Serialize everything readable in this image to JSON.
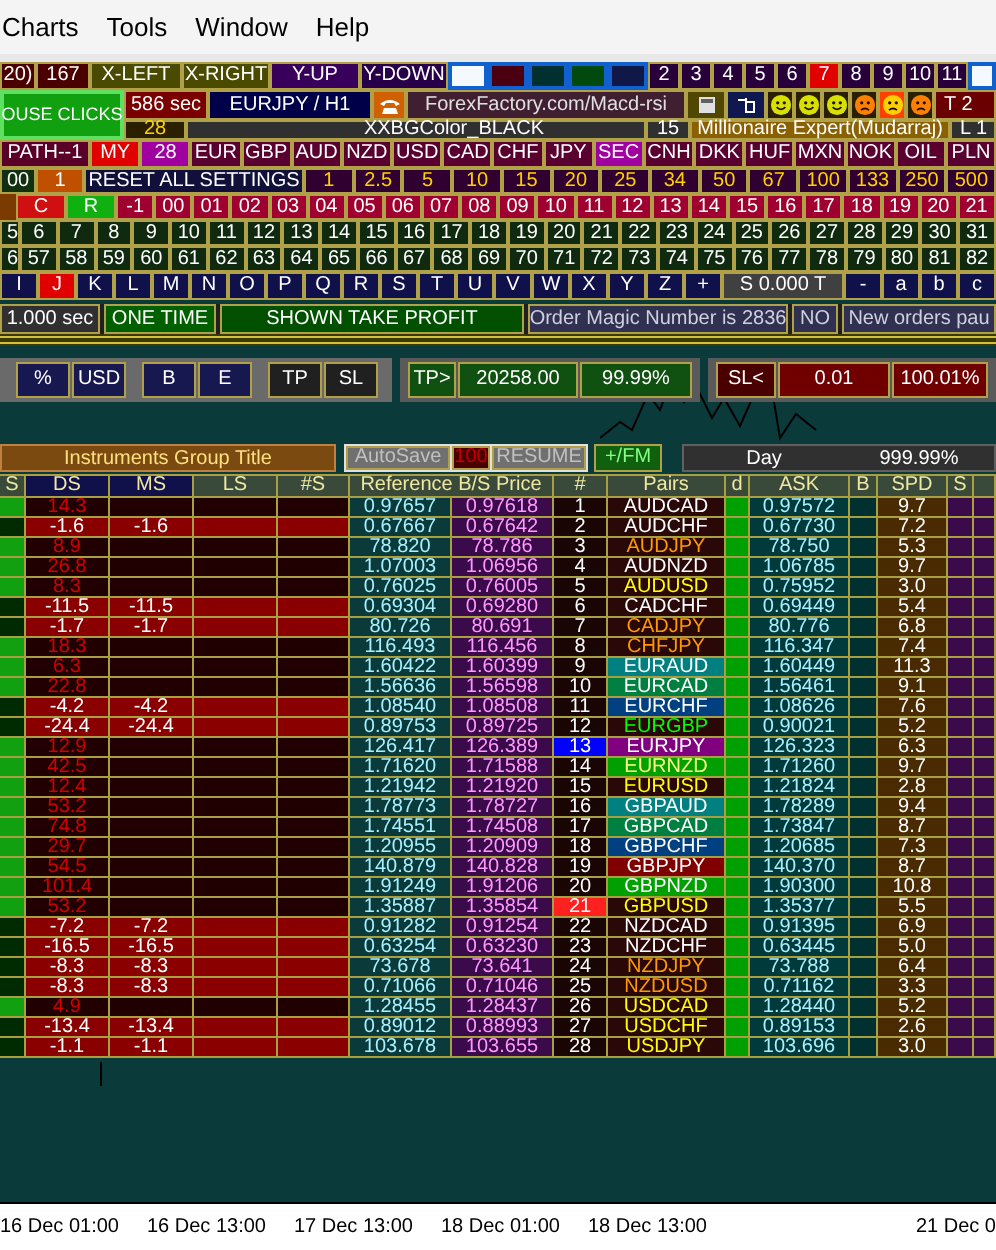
{
  "menu": [
    "Charts",
    "Tools",
    "Window",
    "Help"
  ],
  "toolbar_1": [
    {
      "label": "20)",
      "color": "#4a0000"
    },
    {
      "label": "167",
      "color": "#4a0000"
    },
    {
      "label": "X-LEFT",
      "color": "#4a4a00"
    },
    {
      "label": "X-RIGHT",
      "color": "#4a4a00"
    },
    {
      "label": "Y-UP",
      "color": "#38005a"
    },
    {
      "label": "Y-DOWN",
      "color": "#28004a"
    }
  ],
  "swatches": [
    {
      "color": "#f4f8ff"
    },
    {
      "color": "#4a0010"
    },
    {
      "color": "#003030"
    },
    {
      "color": "#004a10"
    },
    {
      "color": "#101848"
    },
    {
      "color": "#f4f8ff"
    }
  ],
  "chart_numbers": [
    {
      "label": "2"
    },
    {
      "label": "3"
    },
    {
      "label": "4"
    },
    {
      "label": "5"
    },
    {
      "label": "6"
    },
    {
      "label": "7",
      "color": "#e00000"
    },
    {
      "label": "8"
    },
    {
      "label": "9"
    },
    {
      "label": "10"
    },
    {
      "label": "11"
    }
  ],
  "info": {
    "mouse_clicks": "OUSE CLICKS",
    "timer": "586 sec",
    "symbol": "EURJPY / H1",
    "link": "ForexFactory.com/Macd-rsi",
    "corner": "T 2",
    "count": "28",
    "bg_setting": "XXBGColor_BLACK",
    "number": "15",
    "expert": "Millionaire Expert(Mudarraj)",
    "corner_2": "L 1"
  },
  "smileys": [
    {
      "kind": "happy",
      "color": "#d8e000",
      "selected": false
    },
    {
      "kind": "happy",
      "color": "#d8e000",
      "selected": false
    },
    {
      "kind": "happy",
      "color": "#d8e000",
      "selected": false
    },
    {
      "kind": "sad",
      "color": "#ff8000",
      "selected": false
    },
    {
      "kind": "sad",
      "color": "#ffd000",
      "selected": true
    },
    {
      "kind": "sad",
      "color": "#ff8000",
      "selected": false
    }
  ],
  "currencies": [
    {
      "label": "PATH--1",
      "color": "#5a0028"
    },
    {
      "label": "MY",
      "color": "#e00000"
    },
    {
      "label": "28",
      "color": "#a000a0"
    },
    {
      "label": "EUR"
    },
    {
      "label": "GBP"
    },
    {
      "label": "AUD"
    },
    {
      "label": "NZD"
    },
    {
      "label": "USD"
    },
    {
      "label": "CAD"
    },
    {
      "label": "CHF"
    },
    {
      "label": "JPY"
    },
    {
      "label": "SEC",
      "color": "#a000a0"
    },
    {
      "label": "CNH"
    },
    {
      "label": "DKK"
    },
    {
      "label": "HUF"
    },
    {
      "label": "MXN"
    },
    {
      "label": "NOK"
    },
    {
      "label": "OIL"
    },
    {
      "label": "PLN"
    }
  ],
  "settings": [
    {
      "label": "00",
      "color": "#103010"
    },
    {
      "label": "1",
      "color": "#c05000"
    },
    {
      "label": "RESET ALL SETTINGS",
      "color": "#10103a"
    },
    {
      "label": "1"
    },
    {
      "label": "2.5"
    },
    {
      "label": "5"
    },
    {
      "label": "10"
    },
    {
      "label": "15"
    },
    {
      "label": "20"
    },
    {
      "label": "25"
    },
    {
      "label": "34"
    },
    {
      "label": "50"
    },
    {
      "label": "67"
    },
    {
      "label": "100"
    },
    {
      "label": "133"
    },
    {
      "label": "250"
    },
    {
      "label": "500"
    }
  ],
  "minutes": [
    {
      "label": "C",
      "color": "#d01010"
    },
    {
      "label": "R",
      "color": "#10b010"
    },
    {
      "label": "-1"
    },
    {
      "label": "00"
    },
    {
      "label": "01"
    },
    {
      "label": "02"
    },
    {
      "label": "03"
    },
    {
      "label": "04"
    },
    {
      "label": "05"
    },
    {
      "label": "06"
    },
    {
      "label": "07"
    },
    {
      "label": "08"
    },
    {
      "label": "09"
    },
    {
      "label": "10"
    },
    {
      "label": "11"
    },
    {
      "label": "12"
    },
    {
      "label": "13"
    },
    {
      "label": "14"
    },
    {
      "label": "15"
    },
    {
      "label": "16"
    },
    {
      "label": "17"
    },
    {
      "label": "18"
    },
    {
      "label": "19"
    },
    {
      "label": "20"
    },
    {
      "label": "21"
    }
  ],
  "numbers_a": [
    "5",
    "6",
    "7",
    "8",
    "9",
    "10",
    "11",
    "12",
    "13",
    "14",
    "15",
    "16",
    "17",
    "18",
    "19",
    "20",
    "21",
    "22",
    "23",
    "24",
    "25",
    "26",
    "27",
    "28",
    "29",
    "30",
    "31"
  ],
  "numbers_b": [
    "6",
    "57",
    "58",
    "59",
    "60",
    "61",
    "62",
    "63",
    "64",
    "65",
    "66",
    "67",
    "68",
    "69",
    "70",
    "71",
    "72",
    "73",
    "74",
    "75",
    "76",
    "77",
    "78",
    "79",
    "80",
    "81",
    "82"
  ],
  "letters": [
    {
      "label": "I"
    },
    {
      "label": "J",
      "color": "#e00000"
    },
    {
      "label": "K"
    },
    {
      "label": "L"
    },
    {
      "label": "M"
    },
    {
      "label": "N"
    },
    {
      "label": "O"
    },
    {
      "label": "P"
    },
    {
      "label": "Q"
    },
    {
      "label": "R"
    },
    {
      "label": "S"
    },
    {
      "label": "T"
    },
    {
      "label": "U"
    },
    {
      "label": "V"
    },
    {
      "label": "W"
    },
    {
      "label": "X"
    },
    {
      "label": "Y"
    },
    {
      "label": "Z"
    },
    {
      "label": "+"
    },
    {
      "label": "S 0.000 T",
      "color": "#404040"
    },
    {
      "label": "-"
    },
    {
      "label": "a"
    },
    {
      "label": "b"
    },
    {
      "label": "c"
    }
  ],
  "status": [
    {
      "label": "1.000 sec",
      "color": "#303030"
    },
    {
      "label": "ONE TIME",
      "color": "#006000"
    },
    {
      "label": "SHOWN TAKE PROFIT",
      "color": "#005000"
    },
    {
      "label": "Order Magic Number is 2836",
      "color": "#303050"
    },
    {
      "label": "NO",
      "color": "#303050"
    },
    {
      "label": "New orders pau",
      "color": "#303050"
    }
  ],
  "mode_buttons": [
    "%",
    "USD",
    "B",
    "E",
    "TP",
    "SL"
  ],
  "take_profit": [
    "TP>",
    "20258.00",
    "99.99%"
  ],
  "stop_loss": [
    "SL<",
    "0.01",
    "100.01%"
  ],
  "group_title": "Instruments Group Title",
  "autosave": "AutoSave",
  "autosave_value": "100",
  "resume": "RESUME",
  "fm": "+/FM",
  "period": "Day",
  "period_value": "999.99%",
  "columns": [
    "S",
    "DS",
    "MS",
    "LS",
    "#S",
    "Reference B/S Price",
    "#",
    "Pairs",
    "d",
    "ASK",
    "B",
    "SPD",
    "S"
  ],
  "rows": [
    {
      "kind": "up",
      "ds": "14.3",
      "buy": "0.97657",
      "sell": "0.97618",
      "num": "1",
      "pair": {
        "label": "AUDCAD",
        "kind": "white",
        "color": "#2a0808"
      },
      "ask": "0.97572",
      "spd": "9.7"
    },
    {
      "kind": "down",
      "ds": "-1.6",
      "ms": "-1.6",
      "buy": "0.67667",
      "sell": "0.67642",
      "num": "2",
      "pair": {
        "label": "AUDCHF",
        "kind": "white",
        "color": "#2a0808"
      },
      "ask": "0.67730",
      "spd": "7.2"
    },
    {
      "kind": "up",
      "ds": "8.9",
      "buy": "78.820",
      "sell": "78.786",
      "num": "3",
      "pair": {
        "label": "AUDJPY",
        "kind": "orange",
        "color": "#2a0808"
      },
      "ask": "78.750",
      "spd": "5.3"
    },
    {
      "kind": "up",
      "ds": "26.8",
      "buy": "1.07003",
      "sell": "1.06956",
      "num": "4",
      "pair": {
        "label": "AUDNZD",
        "kind": "white",
        "color": "#2a0808"
      },
      "ask": "1.06785",
      "spd": "9.7"
    },
    {
      "kind": "up",
      "ds": "8.3",
      "buy": "0.76025",
      "sell": "0.76005",
      "num": "5",
      "pair": {
        "label": "AUDUSD",
        "kind": "yellow",
        "color": "#2a0808"
      },
      "ask": "0.75952",
      "spd": "3.0"
    },
    {
      "kind": "down",
      "ds": "-11.5",
      "ms": "-11.5",
      "buy": "0.69304",
      "sell": "0.69280",
      "num": "6",
      "pair": {
        "label": "CADCHF",
        "kind": "white",
        "color": "#2a0808"
      },
      "ask": "0.69449",
      "spd": "5.4"
    },
    {
      "kind": "down",
      "ds": "-1.7",
      "ms": "-1.7",
      "buy": "80.726",
      "sell": "80.691",
      "num": "7",
      "pair": {
        "label": "CADJPY",
        "kind": "orange",
        "color": "#2a0808"
      },
      "ask": "80.776",
      "spd": "6.8"
    },
    {
      "kind": "up",
      "ds": "18.3",
      "buy": "116.493",
      "sell": "116.456",
      "num": "8",
      "pair": {
        "label": "CHFJPY",
        "kind": "orange",
        "color": "#2a0808"
      },
      "ask": "116.347",
      "spd": "7.4"
    },
    {
      "kind": "up",
      "ds": "6.3",
      "buy": "1.60422",
      "sell": "1.60399",
      "num": "9",
      "pair": {
        "label": "EURAUD",
        "kind": "white",
        "color": "#008080"
      },
      "ask": "1.60449",
      "spd": "11.3"
    },
    {
      "kind": "up",
      "ds": "22.8",
      "buy": "1.56636",
      "sell": "1.56598",
      "num": "10",
      "pair": {
        "label": "EURCAD",
        "kind": "white",
        "color": "#008040"
      },
      "ask": "1.56461",
      "spd": "9.1"
    },
    {
      "kind": "down",
      "ds": "-4.2",
      "ms": "-4.2",
      "buy": "1.08540",
      "sell": "1.08508",
      "num": "11",
      "pair": {
        "label": "EURCHF",
        "kind": "white",
        "color": "#004080"
      },
      "ask": "1.08626",
      "spd": "7.6"
    },
    {
      "kind": "down",
      "ds": "-24.4",
      "ms": "-24.4",
      "buy": "0.89753",
      "sell": "0.89725",
      "num": "12",
      "pair": {
        "label": "EURGBP",
        "kind": "green",
        "color": "#2a0808"
      },
      "ask": "0.90021",
      "spd": "5.2"
    },
    {
      "kind": "up",
      "ds": "12.9",
      "buy": "126.417",
      "sell": "126.389",
      "num": "13",
      "highlight": {
        "color": "#0000ff"
      },
      "pair": {
        "label": "EURJPY",
        "kind": "white",
        "color": "#800080"
      },
      "ask": "126.323",
      "spd": "6.3"
    },
    {
      "kind": "up",
      "ds": "42.5",
      "buy": "1.71620",
      "sell": "1.71588",
      "num": "14",
      "pair": {
        "label": "EURNZD",
        "kind": "cream",
        "color": "#00a000"
      },
      "ask": "1.71260",
      "spd": "9.7"
    },
    {
      "kind": "up",
      "ds": "12.4",
      "buy": "1.21942",
      "sell": "1.21920",
      "num": "15",
      "pair": {
        "label": "EURUSD",
        "kind": "yellow",
        "color": "#2a0808"
      },
      "ask": "1.21824",
      "spd": "2.8"
    },
    {
      "kind": "up",
      "ds": "53.2",
      "buy": "1.78773",
      "sell": "1.78727",
      "num": "16",
      "pair": {
        "label": "GBPAUD",
        "kind": "white",
        "color": "#008080"
      },
      "ask": "1.78289",
      "spd": "9.4"
    },
    {
      "kind": "up",
      "ds": "74.8",
      "buy": "1.74551",
      "sell": "1.74508",
      "num": "17",
      "pair": {
        "label": "GBPCAD",
        "kind": "white",
        "color": "#008040"
      },
      "ask": "1.73847",
      "spd": "8.7"
    },
    {
      "kind": "up",
      "ds": "29.7",
      "buy": "1.20955",
      "sell": "1.20909",
      "num": "18",
      "pair": {
        "label": "GBPCHF",
        "kind": "white",
        "color": "#004080"
      },
      "ask": "1.20685",
      "spd": "7.3"
    },
    {
      "kind": "up",
      "ds": "54.5",
      "buy": "140.879",
      "sell": "140.828",
      "num": "19",
      "pair": {
        "label": "GBPJPY",
        "kind": "white",
        "color": "#800000"
      },
      "ask": "140.370",
      "spd": "8.7"
    },
    {
      "kind": "up",
      "ds": "101.4",
      "buy": "1.91249",
      "sell": "1.91206",
      "num": "20",
      "pair": {
        "label": "GBPNZD",
        "kind": "white",
        "color": "#00a000"
      },
      "ask": "1.90300",
      "spd": "10.8"
    },
    {
      "kind": "up",
      "ds": "53.2",
      "buy": "1.35887",
      "sell": "1.35854",
      "num": "21",
      "highlight": {
        "color": "#ff2020"
      },
      "pair": {
        "label": "GBPUSD",
        "kind": "yellow",
        "color": "#2a0808"
      },
      "ask": "1.35377",
      "spd": "5.5"
    },
    {
      "kind": "down",
      "ds": "-7.2",
      "ms": "-7.2",
      "buy": "0.91282",
      "sell": "0.91254",
      "num": "22",
      "pair": {
        "label": "NZDCAD",
        "kind": "white",
        "color": "#2a0808"
      },
      "ask": "0.91395",
      "spd": "6.9"
    },
    {
      "kind": "down",
      "ds": "-16.5",
      "ms": "-16.5",
      "buy": "0.63254",
      "sell": "0.63230",
      "num": "23",
      "pair": {
        "label": "NZDCHF",
        "kind": "white",
        "color": "#2a0808"
      },
      "ask": "0.63445",
      "spd": "5.0"
    },
    {
      "kind": "down",
      "ds": "-8.3",
      "ms": "-8.3",
      "buy": "73.678",
      "sell": "73.641",
      "num": "24",
      "pair": {
        "label": "NZDJPY",
        "kind": "orange",
        "color": "#2a0808"
      },
      "ask": "73.788",
      "spd": "6.4"
    },
    {
      "kind": "down",
      "ds": "-8.3",
      "ms": "-8.3",
      "buy": "0.71066",
      "sell": "0.71046",
      "num": "25",
      "pair": {
        "label": "NZDUSD",
        "kind": "orange",
        "color": "#2a0808"
      },
      "ask": "0.71162",
      "spd": "3.3"
    },
    {
      "kind": "up",
      "ds": "4.9",
      "buy": "1.28455",
      "sell": "1.28437",
      "num": "26",
      "pair": {
        "label": "USDCAD",
        "kind": "yellow",
        "color": "#2a0808"
      },
      "ask": "1.28440",
      "spd": "5.2"
    },
    {
      "kind": "down",
      "ds": "-13.4",
      "ms": "-13.4",
      "buy": "0.89012",
      "sell": "0.88993",
      "num": "27",
      "pair": {
        "label": "USDCHF",
        "kind": "yellow",
        "color": "#2a0808"
      },
      "ask": "0.89153",
      "spd": "2.6"
    },
    {
      "kind": "down",
      "ds": "-1.1",
      "ms": "-1.1",
      "buy": "103.678",
      "sell": "103.655",
      "num": "28",
      "pair": {
        "label": "USDJPY",
        "kind": "yellow",
        "color": "#2a0808"
      },
      "ask": "103.696",
      "spd": "3.0"
    }
  ],
  "time_axis": [
    "16 Dec 01:00",
    "16 Dec 13:00",
    "17 Dec 13:00",
    "18 Dec 01:00",
    "18 Dec 13:00",
    "21 Dec 0"
  ]
}
